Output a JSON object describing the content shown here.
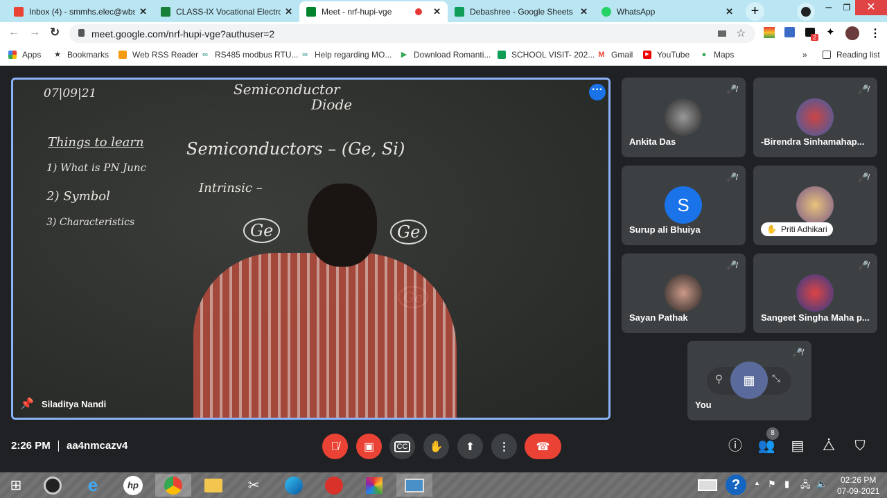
{
  "browser": {
    "tabs": [
      {
        "title": "Inbox (4) - smmhs.elec@wbsct",
        "icon": "gmail-icon",
        "color": "#ea4335"
      },
      {
        "title": "CLASS-IX Vocational Electronic",
        "icon": "classroom-icon",
        "color": "#188038"
      },
      {
        "title": "Meet - nrf-hupi-vge",
        "icon": "meet-icon",
        "color": "#00832d",
        "active": true
      },
      {
        "title": "Debashree - Google Sheets",
        "icon": "sheets-icon",
        "color": "#0f9d58"
      },
      {
        "title": "WhatsApp",
        "icon": "whatsapp-icon",
        "color": "#25d366"
      }
    ],
    "url": "meet.google.com/nrf-hupi-vge?authuser=2",
    "extension_badge": "2",
    "bookmarks": [
      {
        "label": "Apps",
        "icon": "apps-icon"
      },
      {
        "label": "Bookmarks",
        "icon": "star-icon"
      },
      {
        "label": "Web RSS Reader",
        "icon": "rss-icon"
      },
      {
        "label": "RS485 modbus RTU...",
        "icon": "link-icon"
      },
      {
        "label": "Help regarding MO...",
        "icon": "link-icon"
      },
      {
        "label": "Download Romanti...",
        "icon": "play-store-icon"
      },
      {
        "label": "SCHOOL VISIT- 202...",
        "icon": "sheets-icon"
      },
      {
        "label": "Gmail",
        "icon": "gmail-icon"
      },
      {
        "label": "YouTube",
        "icon": "youtube-icon"
      },
      {
        "label": "Maps",
        "icon": "maps-icon"
      }
    ],
    "reading_list": "Reading list"
  },
  "meet": {
    "presenter": "Siladitya Nandi",
    "board": {
      "title1": "Semiconductor",
      "title2": "Diode",
      "date": "07|09|21",
      "heading": "Things to learn",
      "item1": "1) What is PN Junc",
      "item2": "2) Symbol",
      "item3": "3) Characteristics",
      "line1": "Semiconductors – (Ge, Si)",
      "line2": "Intrinsic –",
      "atom": "Ge"
    },
    "participants": [
      {
        "name": "Ankita Das",
        "avatar_color": "#555"
      },
      {
        "name": "-Birendra Sinhamahap...",
        "avatar_color": "#3a5fa8"
      },
      {
        "name": "Surup ali Bhuiya",
        "initial": "S",
        "avatar_color": "#1a73e8"
      },
      {
        "name": "Priti Adhikari",
        "avatar_color": "#c9a36b",
        "hand_raised": true
      },
      {
        "name": "Sayan Pathak",
        "avatar_color": "#6b4a3a"
      },
      {
        "name": "Sangeet Singha Maha p...",
        "avatar_color": "#2d3b8a"
      }
    ],
    "self": {
      "name": "You"
    },
    "time": "2:26 PM",
    "meeting_code": "aa4nmcazv4",
    "people_count": "8"
  },
  "taskbar": {
    "time": "02:26 PM",
    "date": "07-09-2021"
  }
}
